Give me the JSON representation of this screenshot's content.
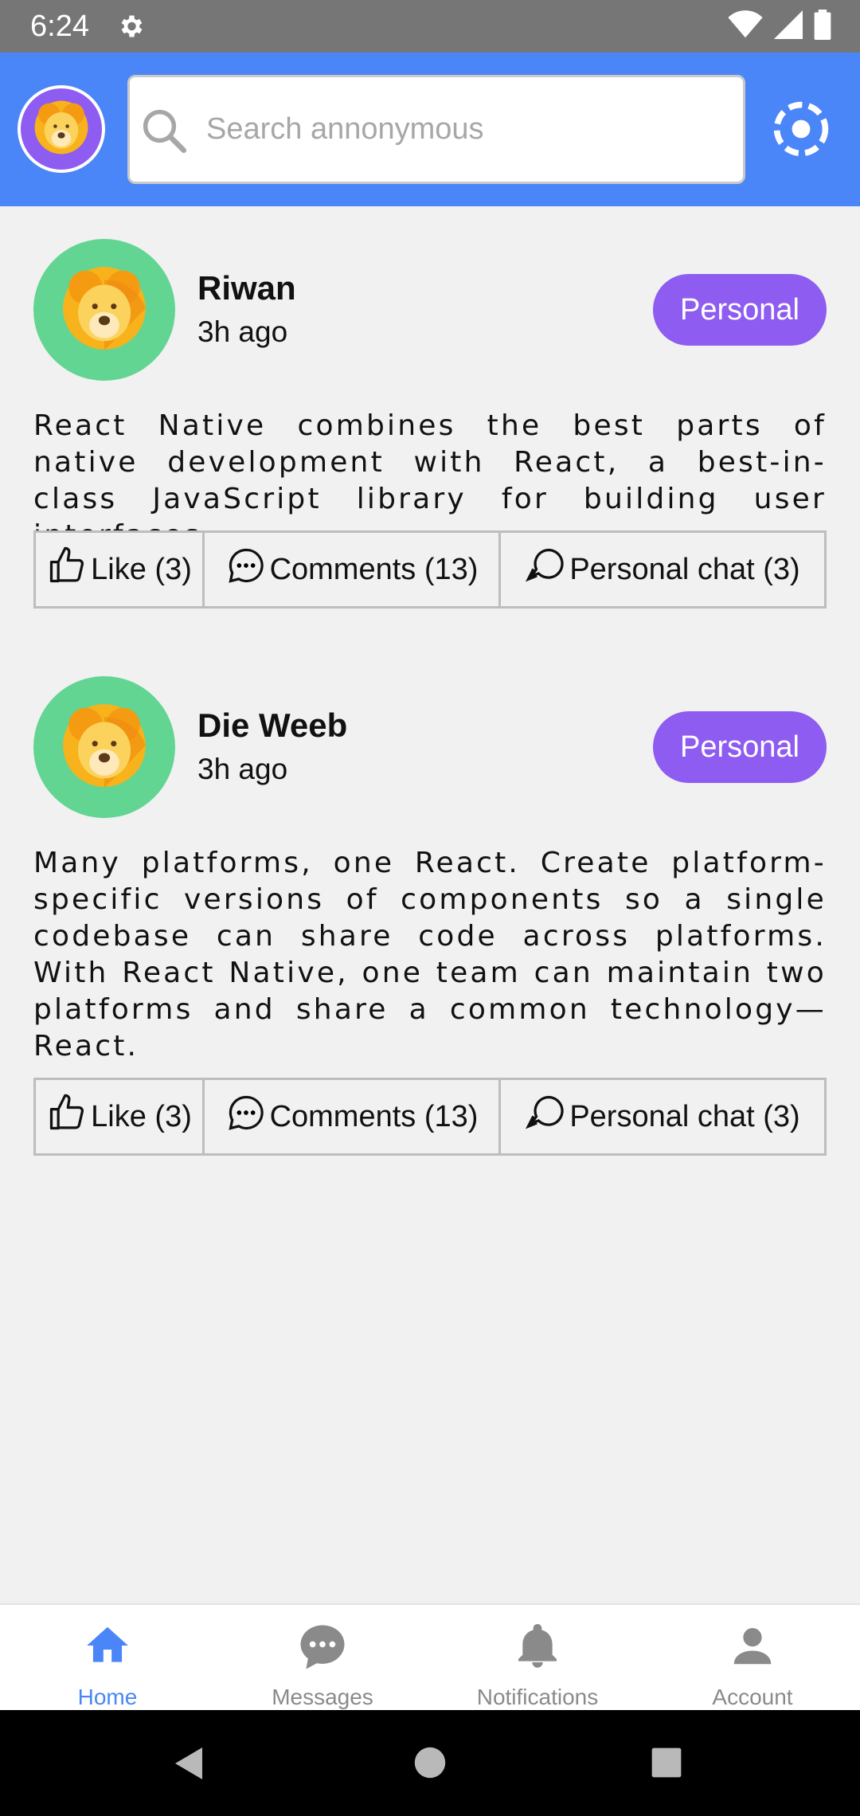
{
  "status_bar": {
    "time": "6:24"
  },
  "header": {
    "search": {
      "placeholder": "Search annonymous"
    }
  },
  "posts": [
    {
      "username": "Riwan",
      "time": "3h ago",
      "badge": "Personal",
      "text": "React Native combines the best parts of native development with React, a best-in-class JavaScript library for building user interfaces.",
      "actions": {
        "like": "Like (3)",
        "comments": "Comments (13)",
        "personal_chat": "Personal chat (3)"
      }
    },
    {
      "username": "Die Weeb",
      "time": "3h ago",
      "badge": "Personal",
      "text": "Many platforms, one React. Create platform-specific versions of components so a single codebase can share code across platforms. With React Native, one team can maintain two platforms and share a common technology—React.",
      "actions": {
        "like": "Like (3)",
        "comments": "Comments (13)",
        "personal_chat": "Personal chat (3)"
      }
    }
  ],
  "bottom_nav": [
    {
      "label": "Home",
      "icon": "home-icon",
      "active": true
    },
    {
      "label": "Messages",
      "icon": "chat-bubble-icon",
      "active": false
    },
    {
      "label": "Notifications",
      "icon": "bell-icon",
      "active": false
    },
    {
      "label": "Account",
      "icon": "person-icon",
      "active": false
    }
  ],
  "colors": {
    "header": "#4a86f7",
    "badge": "#8e5cf0",
    "avatar_bg": "#62d592",
    "active_tab": "#4a86f7"
  }
}
